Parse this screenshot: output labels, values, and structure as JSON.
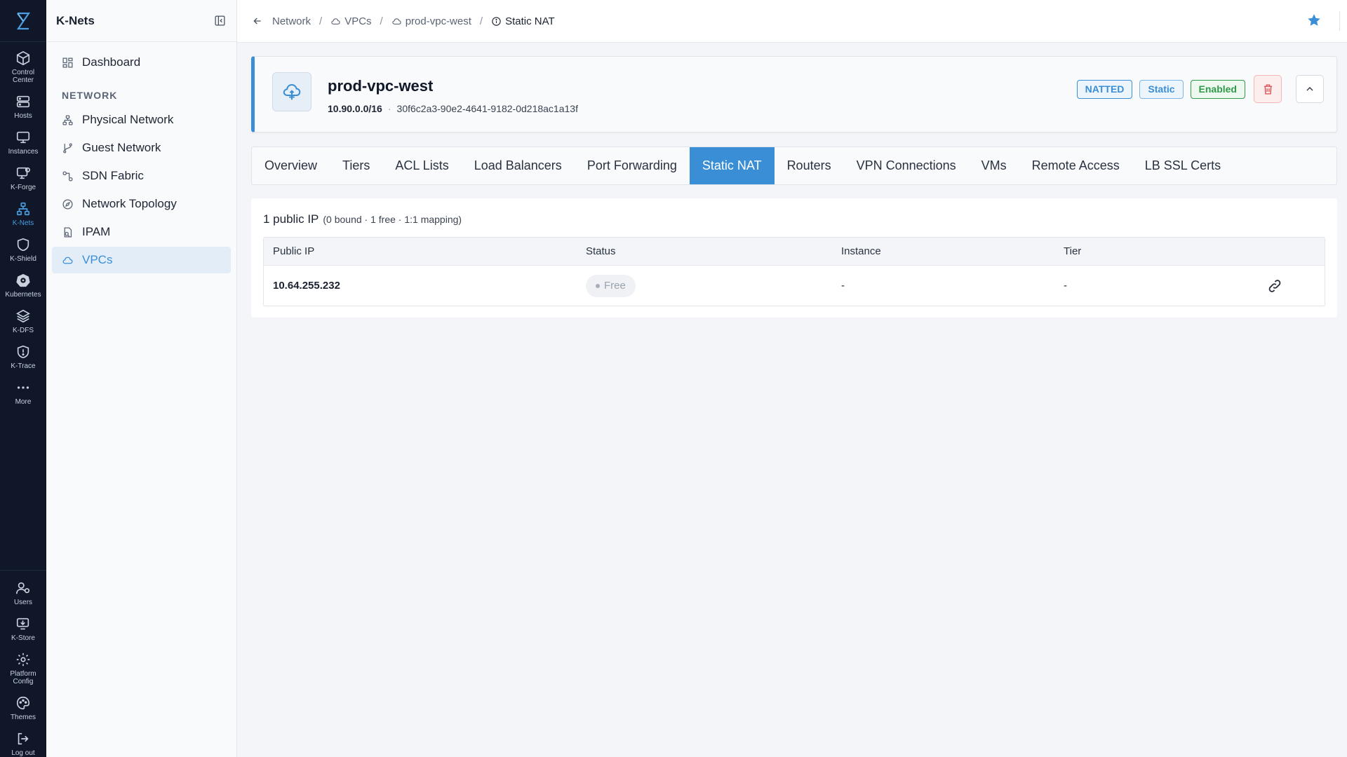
{
  "rail": {
    "top_items": [
      {
        "label": "Control Center",
        "icon": "cube-icon"
      },
      {
        "label": "Hosts",
        "icon": "server-icon"
      },
      {
        "label": "Instances",
        "icon": "monitor-icon"
      },
      {
        "label": "K-Forge",
        "icon": "forge-icon"
      },
      {
        "label": "K-Nets",
        "icon": "network-icon"
      },
      {
        "label": "K-Shield",
        "icon": "shield-icon"
      },
      {
        "label": "Kubernetes",
        "icon": "helm-icon"
      },
      {
        "label": "K-DFS",
        "icon": "layers-icon"
      },
      {
        "label": "K-Trace",
        "icon": "trace-shield-icon"
      },
      {
        "label": "More",
        "icon": "more-icon"
      }
    ],
    "bottom_items": [
      {
        "label": "Users",
        "icon": "users-icon"
      },
      {
        "label": "K-Store",
        "icon": "store-icon"
      },
      {
        "label": "Platform Config",
        "icon": "gear-icon"
      },
      {
        "label": "Themes",
        "icon": "palette-icon"
      },
      {
        "label": "Log out",
        "icon": "logout-icon"
      }
    ],
    "active": "K-Nets",
    "accent": "#4a9ee0"
  },
  "sidebar": {
    "title": "K-Nets",
    "dashboard": "Dashboard",
    "section": "NETWORK",
    "items": [
      {
        "label": "Physical Network",
        "icon": "physical-network-icon"
      },
      {
        "label": "Guest Network",
        "icon": "git-branch-icon"
      },
      {
        "label": "SDN Fabric",
        "icon": "sdn-icon"
      },
      {
        "label": "Network Topology",
        "icon": "compass-icon"
      },
      {
        "label": "IPAM",
        "icon": "ipam-icon"
      },
      {
        "label": "VPCs",
        "icon": "cloud-icon"
      }
    ],
    "active": "VPCs"
  },
  "breadcrumb": {
    "items": [
      "Network",
      "VPCs",
      "prod-vpc-west",
      "Static NAT"
    ],
    "separator": "/"
  },
  "vpc": {
    "name": "prod-vpc-west",
    "cidr": "10.90.0.0/16",
    "separator": "·",
    "id": "30f6c2a3-90e2-4641-9182-0d218ac1a13f",
    "badges": {
      "natted": "NATTED",
      "static": "Static",
      "enabled": "Enabled"
    }
  },
  "tabs": [
    "Overview",
    "Tiers",
    "ACL Lists",
    "Load Balancers",
    "Port Forwarding",
    "Static NAT",
    "Routers",
    "VPN Connections",
    "VMs",
    "Remote Access",
    "LB SSL Certs"
  ],
  "active_tab": "Static NAT",
  "static_nat": {
    "summary": "1 public IP",
    "summary_detail": "(0 bound · 1 free · 1:1 mapping)",
    "columns": [
      "Public IP",
      "Status",
      "Instance",
      "Tier"
    ],
    "rows": [
      {
        "public_ip": "10.64.255.232",
        "status": "Free",
        "instance": "-",
        "tier": "-"
      }
    ]
  },
  "colors": {
    "primary": "#3a8ed6",
    "success": "#2f9a4a",
    "danger": "#e04b4b",
    "rail_bg": "#0f1729"
  }
}
